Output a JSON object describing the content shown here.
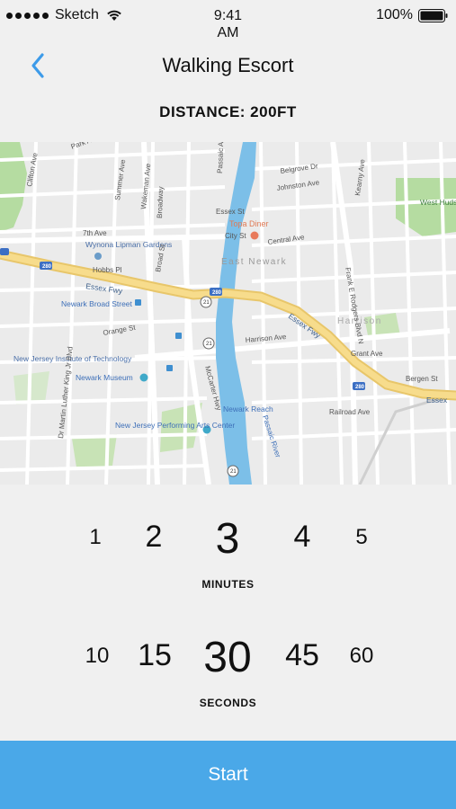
{
  "status_bar": {
    "carrier": "Sketch",
    "time_line1": "9:41",
    "time_line2": "AM",
    "battery": "100%",
    "icons": [
      "signal-dots-icon",
      "wifi-icon",
      "battery-icon"
    ]
  },
  "nav": {
    "title": "Walking Escort",
    "back_icon": "chevron-left-icon",
    "accent": "#3d9be9"
  },
  "distance_label": "DISTANCE: 200FT",
  "map": {
    "labels": {
      "park_ave": "Park Ave",
      "clifton_ave": "Clifton Ave",
      "summer_ave": "Summer Ave",
      "wakeman_ave": "Wakeman Ave",
      "broadway": "Broadway",
      "passaic_ave": "Passaic Ave",
      "belgrove_dr": "Belgrove Dr",
      "johnston_ave": "Johnston Ave",
      "kearny_ave": "Kearny Ave",
      "west_hudson_park": "West Hudson Park",
      "topa_diner": "Topa Diner",
      "seventh_ave": "7th Ave",
      "wynona": "Wynona Lipman Gardens",
      "city_st": "City St",
      "central_ave": "Central Ave",
      "east_newark": "East Newark",
      "hobbs_pl": "Hobbs Pl",
      "essex_fwy_1": "Essex Fwy",
      "essex_fwy_2": "Essex Fwy",
      "essex_fwy_3": "Essex",
      "newark_broad": "Newark Broad Street",
      "harrison": "Harrison",
      "harrison_ave": "Harrison Ave",
      "orange_st": "Orange St",
      "nj_tech": "New Jersey Institute of Technology",
      "newark_museum": "Newark Museum",
      "newark_reach": "Newark Reach",
      "passaic_river": "Passaic River",
      "njpac": "New Jersey Performing Arts Center",
      "mlk": "Dr Martin Luther King Jr Blvd",
      "hwy_280_a": "280",
      "hwy_280_b": "280",
      "hwy_280_c": "280",
      "rt_21_a": "21",
      "rt_21_b": "21",
      "rt_21_c": "21",
      "frank_e_rodgers": "Frank E Rodgers Blvd N",
      "grant_ave": "Grant Ave",
      "bergen_st": "Bergen St",
      "essex_st": "Essex St",
      "railroad_ave": "Railroad Ave",
      "mccarter": "McCarter Hwy",
      "broad_st": "Broad St"
    },
    "colors": {
      "water": "#7cbfe8",
      "park": "#b5dca1",
      "highway": "#f4d47a",
      "road": "#ffffff",
      "block": "#ebebeb"
    }
  },
  "minutes": {
    "options": [
      "1",
      "2",
      "3",
      "4",
      "5"
    ],
    "selected": "3",
    "caption": "MINUTES"
  },
  "seconds": {
    "options": [
      "10",
      "15",
      "30",
      "45",
      "60"
    ],
    "selected": "30",
    "caption": "SECONDS"
  },
  "start_button": {
    "label": "Start",
    "color": "#4aa8e8"
  }
}
